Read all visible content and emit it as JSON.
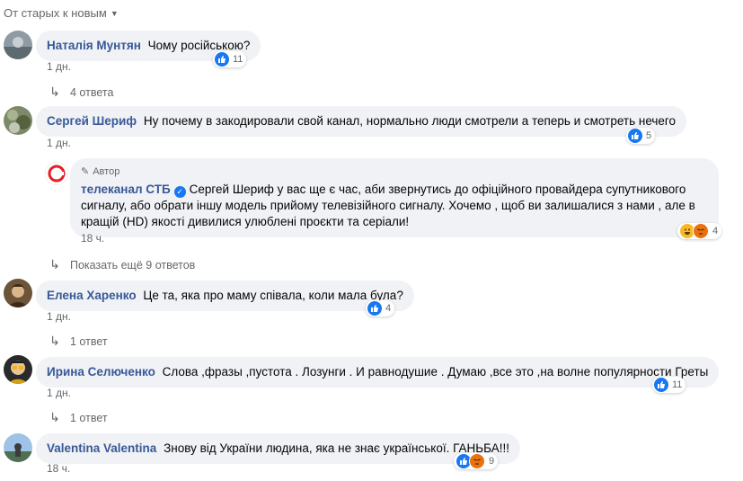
{
  "sort": {
    "label": "От старых к новым"
  },
  "comments": [
    {
      "name": "Наталія Мунтян",
      "text": "Чому російською?",
      "time": "1 дн.",
      "reactions": "11",
      "replies": "4 ответа"
    },
    {
      "name": "Сергей Шериф",
      "text": "Ну почему в закодировали свой канал, нормально люди смотрели а теперь и смотреть нечего",
      "time": "1 дн.",
      "reactions": "5"
    },
    {
      "name": "Елена Харенко",
      "text": "Це та, яка про маму співала, коли мала була?",
      "time": "1 дн.",
      "reactions": "4",
      "replies": "1 ответ"
    },
    {
      "name": "Ирина Селюченко",
      "text": "Слова ,фразы ,пустота . Лозунги . И равнодушие . Думаю ,все это ,на волне популярности Греты",
      "time": "1 дн.",
      "reactions": "11",
      "replies": "1 ответ"
    },
    {
      "name": "Valentina Valentina",
      "text": "Знову від України людина, яка не знає української. ГАНЬБА!!!",
      "time": "18 ч.",
      "reactions": "9"
    }
  ],
  "reply": {
    "author_tag": "Автор",
    "name": "телеканал СТБ",
    "text": "Сергей Шериф у вас ще є час, аби звернутись до офіційного провайдера супутникового сигналу, або обрати іншу модель прийому телевізійного сигналу. Хочемо , щоб ви залишалися з нами , але в кращій (HD) якості дивилися улюблені проєкти та серіали!",
    "time": "18 ч.",
    "reactions": "4"
  },
  "more_replies": "Показать ещё 9 ответов",
  "colors": {
    "accent": "#1877f2",
    "bubble": "#f0f2f5",
    "meta": "#65676b",
    "stb_red": "#e31e24"
  }
}
